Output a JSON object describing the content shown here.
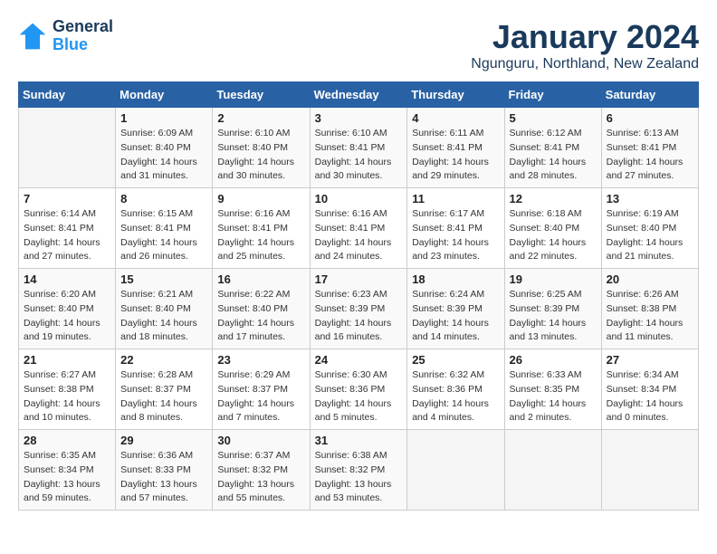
{
  "logo": {
    "line1": "General",
    "line2": "Blue"
  },
  "title": "January 2024",
  "subtitle": "Ngunguru, Northland, New Zealand",
  "days_of_week": [
    "Sunday",
    "Monday",
    "Tuesday",
    "Wednesday",
    "Thursday",
    "Friday",
    "Saturday"
  ],
  "weeks": [
    [
      {
        "day": "",
        "info": ""
      },
      {
        "day": "1",
        "info": "Sunrise: 6:09 AM\nSunset: 8:40 PM\nDaylight: 14 hours\nand 31 minutes."
      },
      {
        "day": "2",
        "info": "Sunrise: 6:10 AM\nSunset: 8:40 PM\nDaylight: 14 hours\nand 30 minutes."
      },
      {
        "day": "3",
        "info": "Sunrise: 6:10 AM\nSunset: 8:41 PM\nDaylight: 14 hours\nand 30 minutes."
      },
      {
        "day": "4",
        "info": "Sunrise: 6:11 AM\nSunset: 8:41 PM\nDaylight: 14 hours\nand 29 minutes."
      },
      {
        "day": "5",
        "info": "Sunrise: 6:12 AM\nSunset: 8:41 PM\nDaylight: 14 hours\nand 28 minutes."
      },
      {
        "day": "6",
        "info": "Sunrise: 6:13 AM\nSunset: 8:41 PM\nDaylight: 14 hours\nand 27 minutes."
      }
    ],
    [
      {
        "day": "7",
        "info": "Sunrise: 6:14 AM\nSunset: 8:41 PM\nDaylight: 14 hours\nand 27 minutes."
      },
      {
        "day": "8",
        "info": "Sunrise: 6:15 AM\nSunset: 8:41 PM\nDaylight: 14 hours\nand 26 minutes."
      },
      {
        "day": "9",
        "info": "Sunrise: 6:16 AM\nSunset: 8:41 PM\nDaylight: 14 hours\nand 25 minutes."
      },
      {
        "day": "10",
        "info": "Sunrise: 6:16 AM\nSunset: 8:41 PM\nDaylight: 14 hours\nand 24 minutes."
      },
      {
        "day": "11",
        "info": "Sunrise: 6:17 AM\nSunset: 8:41 PM\nDaylight: 14 hours\nand 23 minutes."
      },
      {
        "day": "12",
        "info": "Sunrise: 6:18 AM\nSunset: 8:40 PM\nDaylight: 14 hours\nand 22 minutes."
      },
      {
        "day": "13",
        "info": "Sunrise: 6:19 AM\nSunset: 8:40 PM\nDaylight: 14 hours\nand 21 minutes."
      }
    ],
    [
      {
        "day": "14",
        "info": "Sunrise: 6:20 AM\nSunset: 8:40 PM\nDaylight: 14 hours\nand 19 minutes."
      },
      {
        "day": "15",
        "info": "Sunrise: 6:21 AM\nSunset: 8:40 PM\nDaylight: 14 hours\nand 18 minutes."
      },
      {
        "day": "16",
        "info": "Sunrise: 6:22 AM\nSunset: 8:40 PM\nDaylight: 14 hours\nand 17 minutes."
      },
      {
        "day": "17",
        "info": "Sunrise: 6:23 AM\nSunset: 8:39 PM\nDaylight: 14 hours\nand 16 minutes."
      },
      {
        "day": "18",
        "info": "Sunrise: 6:24 AM\nSunset: 8:39 PM\nDaylight: 14 hours\nand 14 minutes."
      },
      {
        "day": "19",
        "info": "Sunrise: 6:25 AM\nSunset: 8:39 PM\nDaylight: 14 hours\nand 13 minutes."
      },
      {
        "day": "20",
        "info": "Sunrise: 6:26 AM\nSunset: 8:38 PM\nDaylight: 14 hours\nand 11 minutes."
      }
    ],
    [
      {
        "day": "21",
        "info": "Sunrise: 6:27 AM\nSunset: 8:38 PM\nDaylight: 14 hours\nand 10 minutes."
      },
      {
        "day": "22",
        "info": "Sunrise: 6:28 AM\nSunset: 8:37 PM\nDaylight: 14 hours\nand 8 minutes."
      },
      {
        "day": "23",
        "info": "Sunrise: 6:29 AM\nSunset: 8:37 PM\nDaylight: 14 hours\nand 7 minutes."
      },
      {
        "day": "24",
        "info": "Sunrise: 6:30 AM\nSunset: 8:36 PM\nDaylight: 14 hours\nand 5 minutes."
      },
      {
        "day": "25",
        "info": "Sunrise: 6:32 AM\nSunset: 8:36 PM\nDaylight: 14 hours\nand 4 minutes."
      },
      {
        "day": "26",
        "info": "Sunrise: 6:33 AM\nSunset: 8:35 PM\nDaylight: 14 hours\nand 2 minutes."
      },
      {
        "day": "27",
        "info": "Sunrise: 6:34 AM\nSunset: 8:34 PM\nDaylight: 14 hours\nand 0 minutes."
      }
    ],
    [
      {
        "day": "28",
        "info": "Sunrise: 6:35 AM\nSunset: 8:34 PM\nDaylight: 13 hours\nand 59 minutes."
      },
      {
        "day": "29",
        "info": "Sunrise: 6:36 AM\nSunset: 8:33 PM\nDaylight: 13 hours\nand 57 minutes."
      },
      {
        "day": "30",
        "info": "Sunrise: 6:37 AM\nSunset: 8:32 PM\nDaylight: 13 hours\nand 55 minutes."
      },
      {
        "day": "31",
        "info": "Sunrise: 6:38 AM\nSunset: 8:32 PM\nDaylight: 13 hours\nand 53 minutes."
      },
      {
        "day": "",
        "info": ""
      },
      {
        "day": "",
        "info": ""
      },
      {
        "day": "",
        "info": ""
      }
    ]
  ]
}
